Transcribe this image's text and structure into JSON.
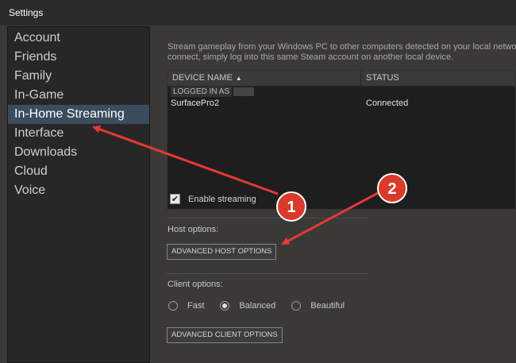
{
  "window": {
    "title": "Settings"
  },
  "sidebar": {
    "items": [
      {
        "label": "Account",
        "active": false
      },
      {
        "label": "Friends",
        "active": false
      },
      {
        "label": "Family",
        "active": false
      },
      {
        "label": "In-Game",
        "active": false
      },
      {
        "label": "In-Home Streaming",
        "active": true
      },
      {
        "label": "Interface",
        "active": false
      },
      {
        "label": "Downloads",
        "active": false
      },
      {
        "label": "Cloud",
        "active": false
      },
      {
        "label": "Voice",
        "active": false
      }
    ]
  },
  "main": {
    "description_line1": "Stream gameplay from your Windows PC to other computers detected on your local netwo",
    "description_line2": "connect, simply log into this same Steam account on another local device.",
    "table": {
      "col_device": "DEVICE NAME",
      "col_status": "STATUS",
      "logged_in_label": "LOGGED IN AS",
      "rows": [
        {
          "device": "SurfacePro2",
          "status": "Connected"
        }
      ]
    },
    "enable_streaming": {
      "label": "Enable streaming",
      "checked": true
    },
    "host_options_label": "Host options:",
    "advanced_host_button": "ADVANCED HOST OPTIONS",
    "client_options_label": "Client options:",
    "client_radios": [
      {
        "label": "Fast",
        "selected": false
      },
      {
        "label": "Balanced",
        "selected": true
      },
      {
        "label": "Beautiful",
        "selected": false
      }
    ],
    "advanced_client_button": "ADVANCED CLIENT OPTIONS"
  },
  "annotations": {
    "badge1": "1",
    "badge2": "2",
    "arrow_color": "#e53935",
    "badge_color": "#d93a2b"
  }
}
